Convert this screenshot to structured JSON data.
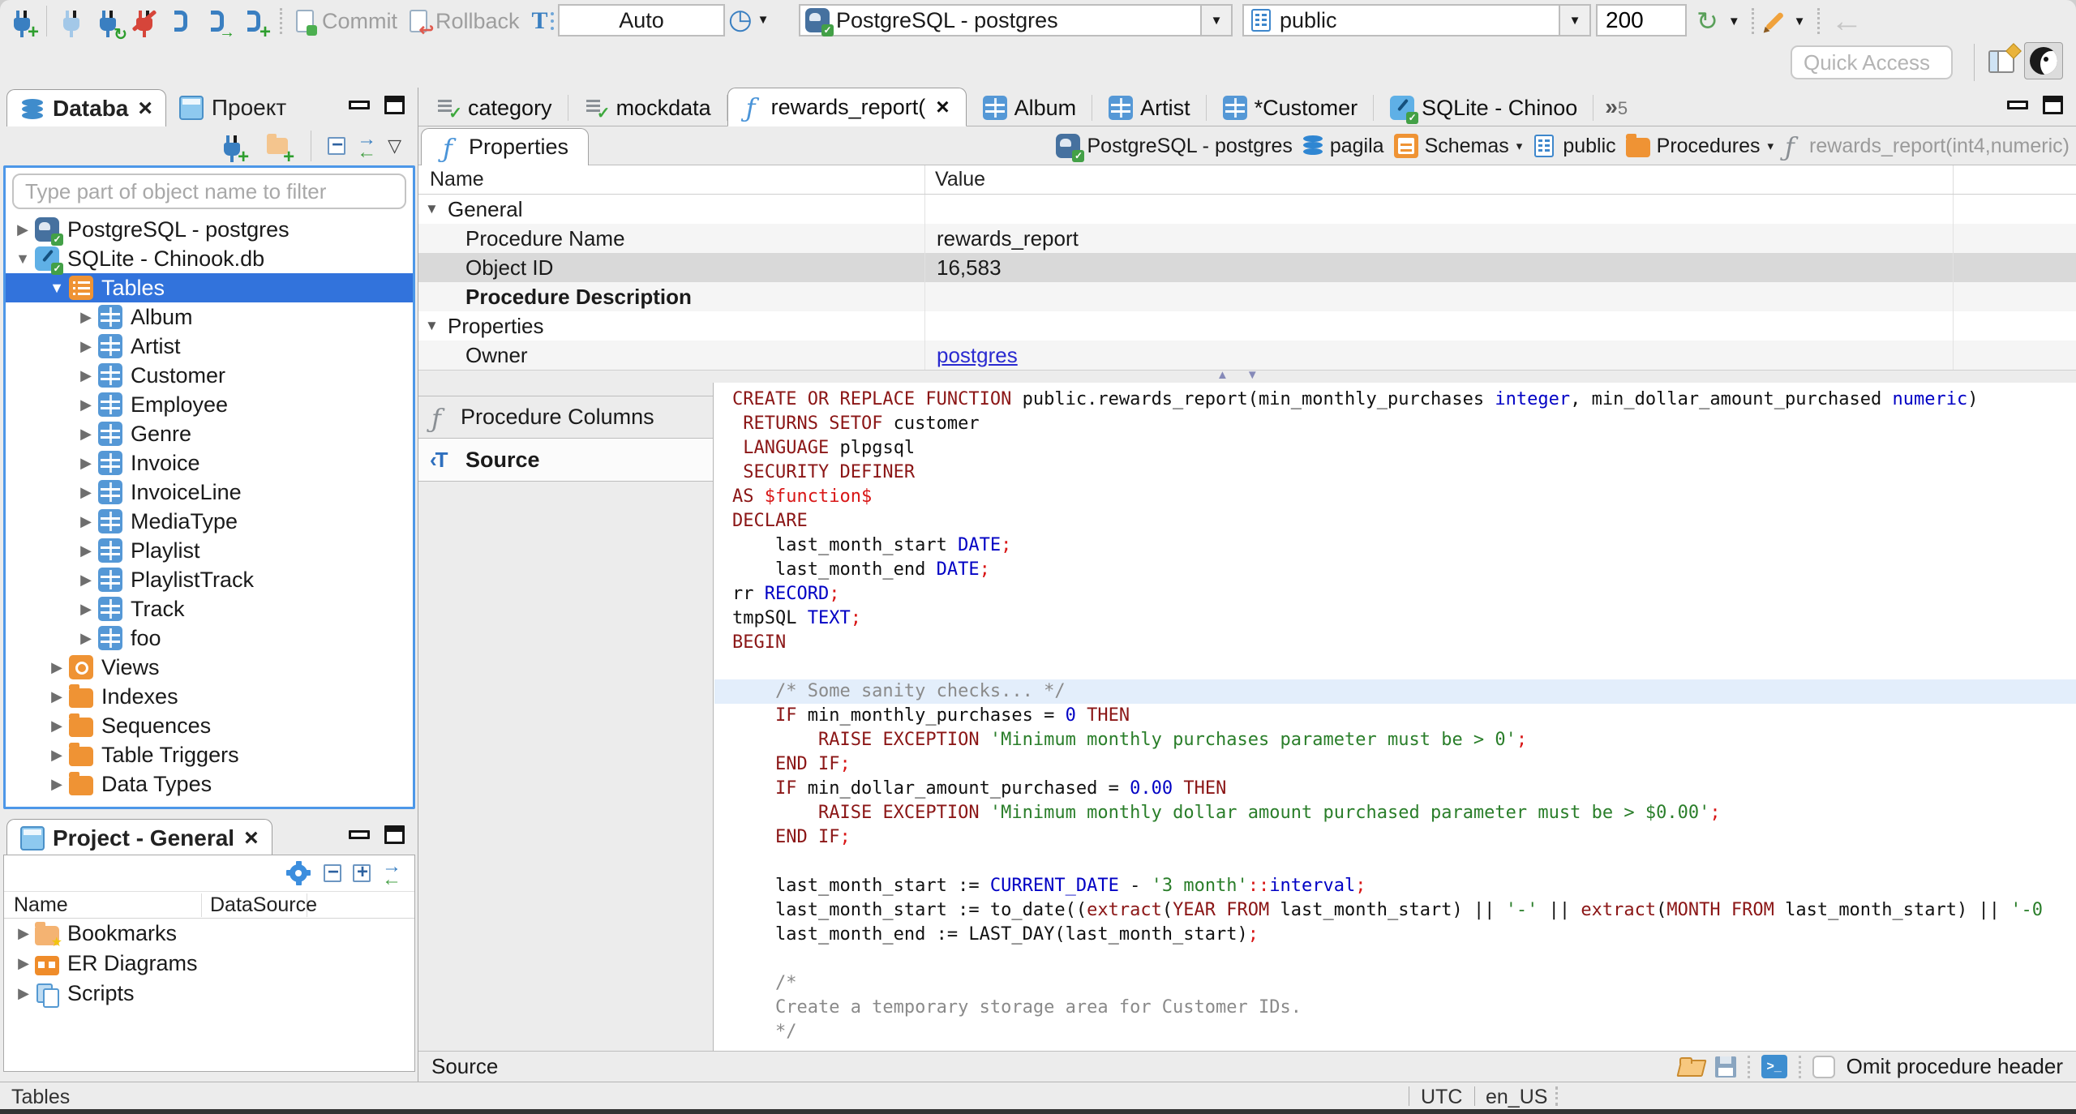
{
  "toolbar": {
    "commit_label": "Commit",
    "rollback_label": "Rollback",
    "auto_label": "Auto",
    "connection_combo": "PostgreSQL - postgres",
    "schema_combo": "public",
    "fetch_size": "200",
    "quick_access_placeholder": "Quick Access"
  },
  "navigator": {
    "tab_database": "Databa",
    "tab_project": "Проект",
    "filter_placeholder": "Type part of object name to filter",
    "tree": [
      {
        "label": "PostgreSQL - postgres",
        "icon": "postgres-connection",
        "level": 0,
        "twisty": "collapsed"
      },
      {
        "label": "SQLite - Chinook.db",
        "icon": "sqlite-connection",
        "level": 0,
        "twisty": "expanded"
      },
      {
        "label": "Tables",
        "icon": "tables-folder",
        "level": 1,
        "twisty": "expanded",
        "selected": true
      },
      {
        "label": "Album",
        "icon": "table",
        "level": 2,
        "twisty": "collapsed"
      },
      {
        "label": "Artist",
        "icon": "table",
        "level": 2,
        "twisty": "collapsed"
      },
      {
        "label": "Customer",
        "icon": "table",
        "level": 2,
        "twisty": "collapsed"
      },
      {
        "label": "Employee",
        "icon": "table",
        "level": 2,
        "twisty": "collapsed"
      },
      {
        "label": "Genre",
        "icon": "table",
        "level": 2,
        "twisty": "collapsed"
      },
      {
        "label": "Invoice",
        "icon": "table",
        "level": 2,
        "twisty": "collapsed"
      },
      {
        "label": "InvoiceLine",
        "icon": "table",
        "level": 2,
        "twisty": "collapsed"
      },
      {
        "label": "MediaType",
        "icon": "table",
        "level": 2,
        "twisty": "collapsed"
      },
      {
        "label": "Playlist",
        "icon": "table",
        "level": 2,
        "twisty": "collapsed"
      },
      {
        "label": "PlaylistTrack",
        "icon": "table",
        "level": 2,
        "twisty": "collapsed"
      },
      {
        "label": "Track",
        "icon": "table",
        "level": 2,
        "twisty": "collapsed"
      },
      {
        "label": "foo",
        "icon": "table",
        "level": 2,
        "twisty": "collapsed"
      },
      {
        "label": "Views",
        "icon": "views-folder",
        "level": 1,
        "twisty": "collapsed"
      },
      {
        "label": "Indexes",
        "icon": "folder",
        "level": 1,
        "twisty": "collapsed"
      },
      {
        "label": "Sequences",
        "icon": "folder",
        "level": 1,
        "twisty": "collapsed"
      },
      {
        "label": "Table Triggers",
        "icon": "folder",
        "level": 1,
        "twisty": "collapsed"
      },
      {
        "label": "Data Types",
        "icon": "folder",
        "level": 1,
        "twisty": "collapsed"
      }
    ]
  },
  "project_panel": {
    "title": "Project - General",
    "columns": [
      "Name",
      "DataSource"
    ],
    "items": [
      {
        "label": "Bookmarks",
        "icon": "bookmarks-folder"
      },
      {
        "label": "ER Diagrams",
        "icon": "er-folder"
      },
      {
        "label": "Scripts",
        "icon": "scripts"
      }
    ]
  },
  "editor_tabs": [
    {
      "label": "category",
      "icon": "script-check"
    },
    {
      "label": "mockdata",
      "icon": "script-check"
    },
    {
      "label": "rewards_report(",
      "icon": "function",
      "active": true,
      "closable": true
    },
    {
      "label": "Album",
      "icon": "table"
    },
    {
      "label": "Artist",
      "icon": "table"
    },
    {
      "label": "*Customer",
      "icon": "table"
    },
    {
      "label": "SQLite - Chinoo",
      "icon": "sqlite"
    }
  ],
  "tab_overflow": "5",
  "object_editor": {
    "properties_tab": "Properties",
    "breadcrumb": [
      {
        "label": "PostgreSQL - postgres",
        "icon": "postgres-connection"
      },
      {
        "label": "pagila",
        "icon": "database"
      },
      {
        "label": "Schemas",
        "icon": "schemas-folder",
        "dropdown": true
      },
      {
        "label": "public",
        "icon": "schema"
      },
      {
        "label": "Procedures",
        "icon": "folder",
        "dropdown": true
      },
      {
        "label": "rewards_report(int4,numeric)",
        "icon": "function",
        "muted": true
      }
    ],
    "grid": {
      "name_col": "Name",
      "value_col": "Value",
      "rows": [
        {
          "name": "General",
          "type": "group"
        },
        {
          "name": "Procedure Name",
          "value": "rewards_report",
          "type": "item"
        },
        {
          "name": "Object ID",
          "value": "16,583",
          "type": "item",
          "selected": true
        },
        {
          "name": "Procedure Description",
          "type": "item",
          "bold": true
        },
        {
          "name": "Properties",
          "type": "group"
        },
        {
          "name": "Owner",
          "value": "postgres",
          "type": "item",
          "link": true
        }
      ]
    },
    "side_tabs": [
      {
        "label": "Procedure Columns",
        "icon": "function"
      },
      {
        "label": "Source",
        "icon": "source-tab",
        "selected": true
      }
    ],
    "bottom_bar": {
      "page_label": "Source",
      "omit_label": "Omit procedure header"
    }
  },
  "source_code": {
    "lines": [
      {
        "seg": [
          [
            "k",
            "CREATE OR REPLACE FUNCTION "
          ],
          [
            "p",
            "public.rewards_report(min_monthly_purchases "
          ],
          [
            "t",
            "integer"
          ],
          [
            "p",
            ", min_dollar_amount_purchased "
          ],
          [
            "t",
            "numeric"
          ],
          [
            "p",
            ")"
          ]
        ]
      },
      {
        "seg": [
          [
            "p",
            " "
          ],
          [
            "k",
            "RETURNS SETOF"
          ],
          [
            "p",
            " customer"
          ]
        ]
      },
      {
        "seg": [
          [
            "p",
            " "
          ],
          [
            "k",
            "LANGUAGE"
          ],
          [
            "p",
            " plpgsql"
          ]
        ]
      },
      {
        "seg": [
          [
            "p",
            " "
          ],
          [
            "k",
            "SECURITY DEFINER"
          ]
        ]
      },
      {
        "seg": [
          [
            "k",
            "AS"
          ],
          [
            "p",
            " "
          ],
          [
            "r",
            "$function$"
          ]
        ]
      },
      {
        "seg": [
          [
            "k",
            "DECLARE"
          ]
        ]
      },
      {
        "seg": [
          [
            "p",
            "    last_month_start "
          ],
          [
            "t",
            "DATE"
          ],
          [
            "r",
            ";"
          ]
        ]
      },
      {
        "seg": [
          [
            "p",
            "    last_month_end "
          ],
          [
            "t",
            "DATE"
          ],
          [
            "r",
            ";"
          ]
        ]
      },
      {
        "seg": [
          [
            "p",
            "rr "
          ],
          [
            "t",
            "RECORD"
          ],
          [
            "r",
            ";"
          ]
        ]
      },
      {
        "seg": [
          [
            "p",
            "tmpSQL "
          ],
          [
            "t",
            "TEXT"
          ],
          [
            "r",
            ";"
          ]
        ]
      },
      {
        "seg": [
          [
            "k",
            "BEGIN"
          ]
        ]
      },
      {
        "seg": []
      },
      {
        "hl": true,
        "seg": [
          [
            "c",
            "    /* Some sanity checks... */"
          ]
        ]
      },
      {
        "seg": [
          [
            "p",
            "    "
          ],
          [
            "k",
            "IF"
          ],
          [
            "p",
            " min_monthly_purchases = "
          ],
          [
            "t",
            "0"
          ],
          [
            "p",
            " "
          ],
          [
            "k",
            "THEN"
          ]
        ]
      },
      {
        "seg": [
          [
            "p",
            "        "
          ],
          [
            "k",
            "RAISE EXCEPTION"
          ],
          [
            "p",
            " "
          ],
          [
            "s",
            "'Minimum monthly purchases parameter must be > 0'"
          ],
          [
            "r",
            ";"
          ]
        ]
      },
      {
        "seg": [
          [
            "p",
            "    "
          ],
          [
            "k",
            "END IF"
          ],
          [
            "r",
            ";"
          ]
        ]
      },
      {
        "seg": [
          [
            "p",
            "    "
          ],
          [
            "k",
            "IF"
          ],
          [
            "p",
            " min_dollar_amount_purchased = "
          ],
          [
            "t",
            "0.00"
          ],
          [
            "p",
            " "
          ],
          [
            "k",
            "THEN"
          ]
        ]
      },
      {
        "seg": [
          [
            "p",
            "        "
          ],
          [
            "k",
            "RAISE EXCEPTION"
          ],
          [
            "p",
            " "
          ],
          [
            "s",
            "'Minimum monthly dollar amount purchased parameter must be > $0.00'"
          ],
          [
            "r",
            ";"
          ]
        ]
      },
      {
        "seg": [
          [
            "p",
            "    "
          ],
          [
            "k",
            "END IF"
          ],
          [
            "r",
            ";"
          ]
        ]
      },
      {
        "seg": []
      },
      {
        "seg": [
          [
            "p",
            "    last_month_start := "
          ],
          [
            "t",
            "CURRENT_DATE"
          ],
          [
            "p",
            " - "
          ],
          [
            "s",
            "'3 month'"
          ],
          [
            "r",
            "::"
          ],
          [
            "t",
            "interval"
          ],
          [
            "r",
            ";"
          ]
        ]
      },
      {
        "seg": [
          [
            "p",
            "    last_month_start := to_date(("
          ],
          [
            "k",
            "extract"
          ],
          [
            "p",
            "("
          ],
          [
            "k",
            "YEAR FROM"
          ],
          [
            "p",
            " last_month_start) || "
          ],
          [
            "s",
            "'-'"
          ],
          [
            "p",
            " || "
          ],
          [
            "k",
            "extract"
          ],
          [
            "p",
            "("
          ],
          [
            "k",
            "MONTH FROM"
          ],
          [
            "p",
            " last_month_start) || "
          ],
          [
            "s",
            "'-0"
          ]
        ]
      },
      {
        "seg": [
          [
            "p",
            "    last_month_end := LAST_DAY(last_month_start)"
          ],
          [
            "r",
            ";"
          ]
        ]
      },
      {
        "seg": []
      },
      {
        "seg": [
          [
            "c",
            "    /*"
          ]
        ]
      },
      {
        "seg": [
          [
            "c",
            "    Create a temporary storage area for Customer IDs."
          ]
        ]
      },
      {
        "seg": [
          [
            "c",
            "    */"
          ]
        ]
      }
    ]
  },
  "status_bar": {
    "left": "Tables",
    "timezone": "UTC",
    "locale": "en_US"
  },
  "icons": {
    "close": "×",
    "chevron_down": "▾",
    "caret_down": "▼",
    "triangle_collapsed": "▶",
    "triangle_expanded": "▼",
    "menu_triangle": "▽",
    "overflow": "»",
    "splitter_up": "▲",
    "splitter_down": "▼",
    "clock": "◷",
    "refresh": "↻",
    "undo": "←"
  },
  "colors": {
    "selection_blue": "#3273dc",
    "focus_border": "#4d97e8",
    "keyword": "#8b1616",
    "datatype": "#0000c4",
    "string": "#2a7e2a",
    "error_red": "#d81616",
    "comment": "#8a8a8a",
    "link": "#2a2ad0",
    "folder_orange": "#ef9334",
    "table_blue": "#5598d6"
  }
}
